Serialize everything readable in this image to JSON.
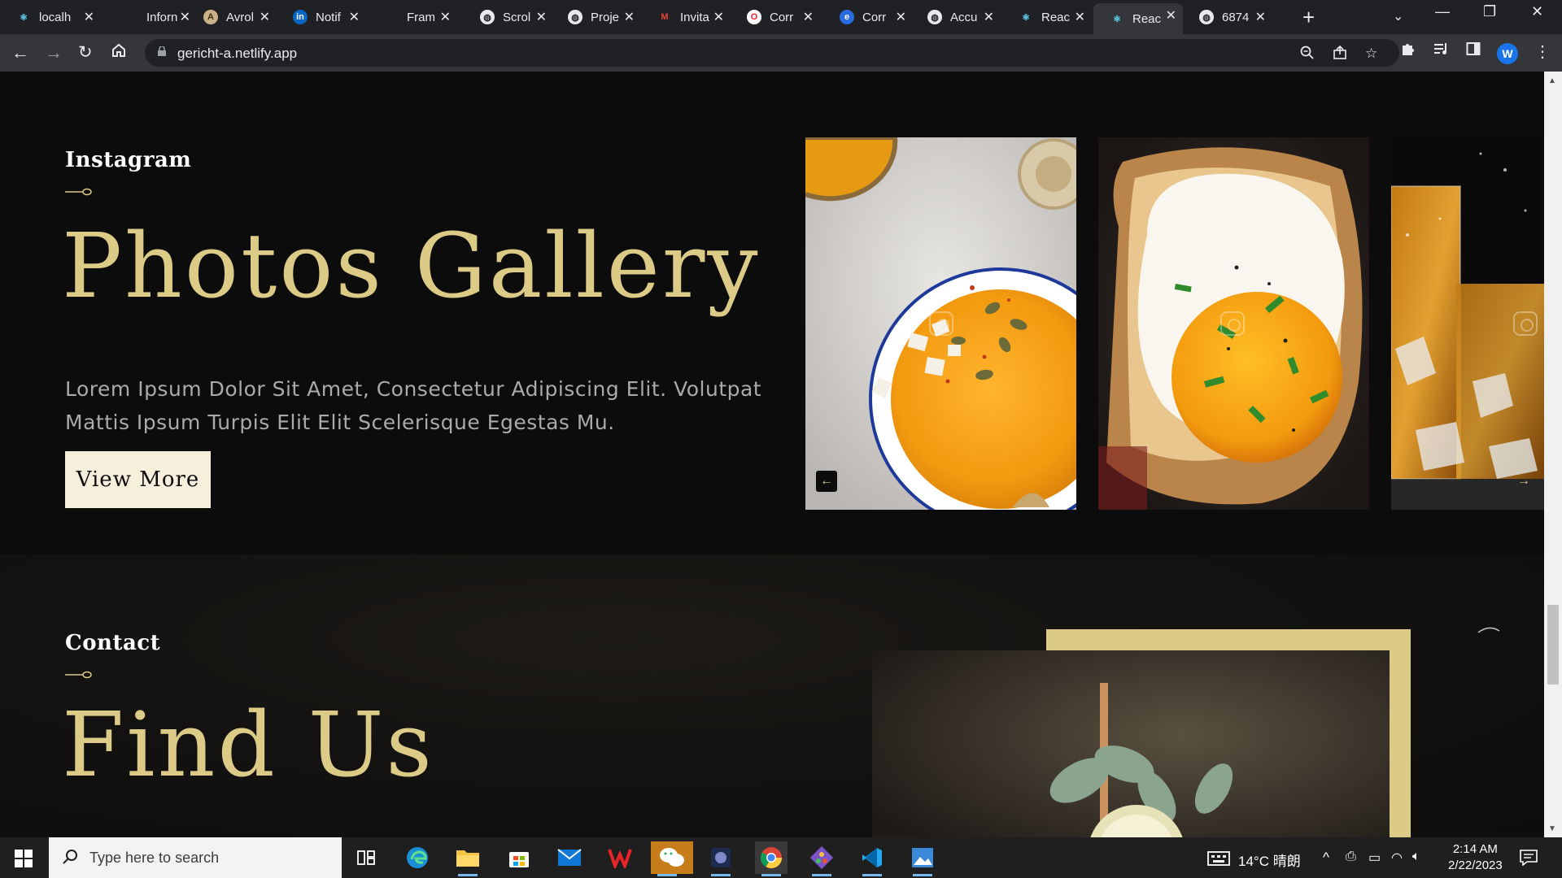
{
  "browser": {
    "tabs": [
      {
        "label": "localh",
        "icon": "react-icon"
      },
      {
        "label": "Inforn",
        "icon": "blank-icon"
      },
      {
        "label": "Avrol",
        "icon": "a-icon"
      },
      {
        "label": "Notif",
        "icon": "linkedin-icon"
      },
      {
        "label": "Fram",
        "icon": "blank-icon"
      },
      {
        "label": "Scrol",
        "icon": "globe-icon"
      },
      {
        "label": "Proje",
        "icon": "globe-icon"
      },
      {
        "label": "Invita",
        "icon": "gmail-icon"
      },
      {
        "label": "Corr",
        "icon": "opera-icon"
      },
      {
        "label": "Corr",
        "icon": "edge-icon"
      },
      {
        "label": "Accu",
        "icon": "globe-icon"
      },
      {
        "label": "Reac",
        "icon": "react-icon"
      },
      {
        "label": "Reac",
        "icon": "react-icon"
      },
      {
        "label": "6874",
        "icon": "globe-icon"
      }
    ],
    "active_tab_index": 12,
    "url": "gericht-a.netlify.app",
    "profile_initial": "W",
    "accent": "#1a73e8"
  },
  "gallery": {
    "subtitle": "Instagram",
    "title": "Photos Gallery",
    "lead": "Lorem Ipsum Dolor Sit Amet, Consectetur Adipiscing Elit. Volutpat Mattis Ipsum Turpis Elit Elit Scelerisque Egestas Mu.",
    "button": "View More",
    "photos": [
      "pumpkin soup bowl",
      "fried egg on toast",
      "whisky glass with ice"
    ],
    "gold": "#dcca87"
  },
  "contact": {
    "subtitle": "Contact",
    "title": "Find Us"
  },
  "taskbar": {
    "search_placeholder": "Type here to search",
    "weather": "14°C 晴朗",
    "time": "2:14 AM",
    "date": "2/22/2023"
  }
}
